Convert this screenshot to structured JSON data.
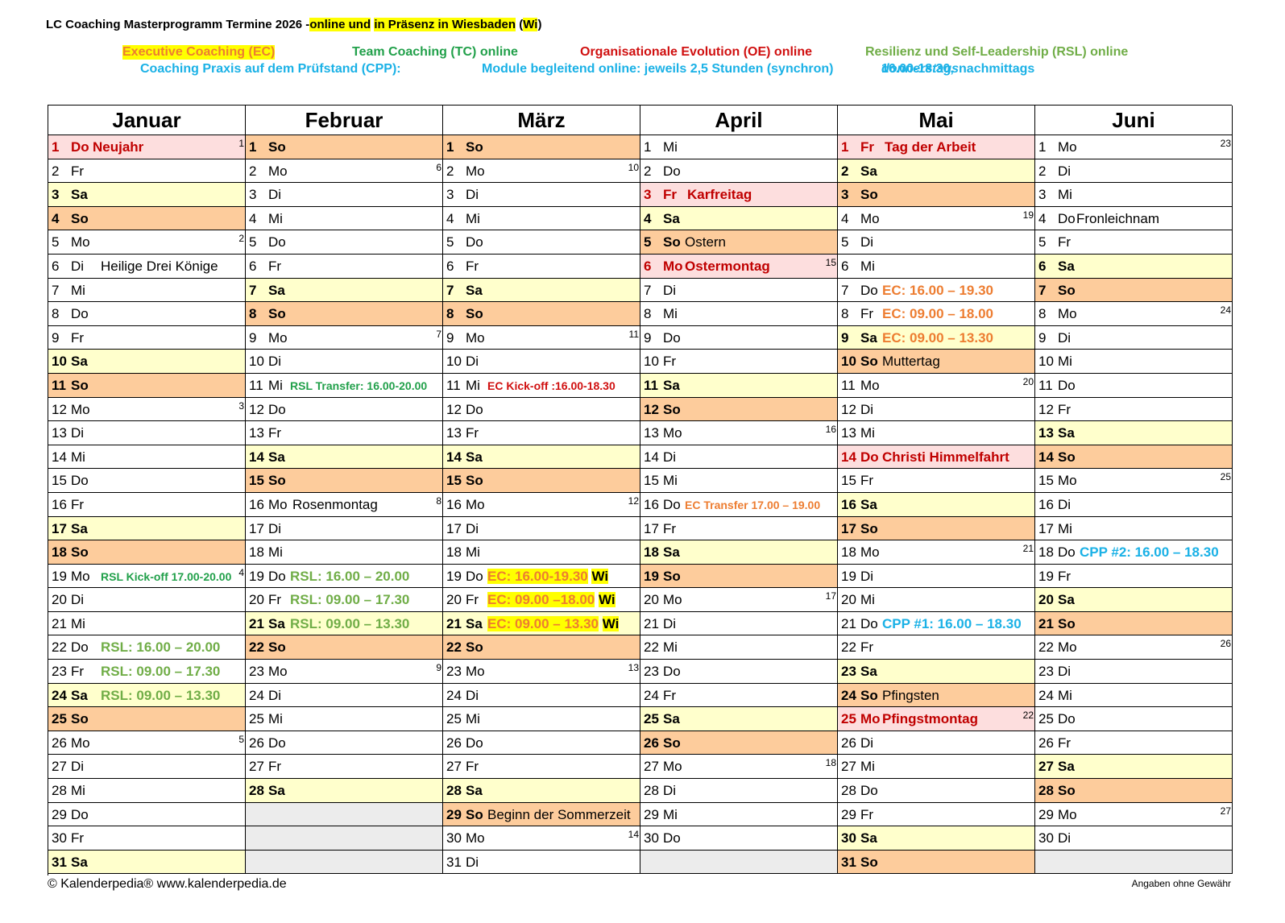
{
  "title": {
    "main": "LC Coaching Masterprogramm Termine 2026 -",
    "hl1": "online und",
    "mid": " ",
    "hl2": "in Präsenz in Wiesbaden",
    "paren_open": " (",
    "hl3": "Wi",
    "paren_close": ")"
  },
  "legend": {
    "ec": "Executive Coaching (EC)",
    "tc": "Team Coaching (TC) online",
    "oe": "Organisationale Evolution (OE) online",
    "rsl": "Resilienz und Self-Leadership (RSL) online",
    "cpp": "Coaching Praxis auf dem Prüfstand (CPP):",
    "modules": "Module begleitend online: jeweils 2,5 Stunden (synchron)",
    "time": "16.00-18.30,",
    "weekday": "donnerstags",
    "afternoon": "nachmittags"
  },
  "colors": {
    "ec": "#ed7d31",
    "tc": "#21a04a",
    "oe": "#d01010",
    "rsl": "#70ad47",
    "cpp": "#1ab1e6",
    "saturday": "#ffffcc",
    "sunday": "#fdcc9c",
    "holiday": "#fddede"
  },
  "months": [
    {
      "name": "Januar",
      "days": [
        {
          "n": "1",
          "d": "Do",
          "t": "hol",
          "note": "Neujahr",
          "cls": "",
          "wk": "1"
        },
        {
          "n": "2",
          "d": "Fr"
        },
        {
          "n": "3",
          "d": "Sa",
          "t": "sa"
        },
        {
          "n": "4",
          "d": "So",
          "t": "so"
        },
        {
          "n": "5",
          "d": "Mo",
          "wk": "2"
        },
        {
          "n": "6",
          "d": "Di",
          "note": "Heilige Drei Könige",
          "pos": "wide"
        },
        {
          "n": "7",
          "d": "Mi"
        },
        {
          "n": "8",
          "d": "Do"
        },
        {
          "n": "9",
          "d": "Fr"
        },
        {
          "n": "10",
          "d": "Sa",
          "t": "sa"
        },
        {
          "n": "11",
          "d": "So",
          "t": "so"
        },
        {
          "n": "12",
          "d": "Mo",
          "wk": "3"
        },
        {
          "n": "13",
          "d": "Di"
        },
        {
          "n": "14",
          "d": "Mi"
        },
        {
          "n": "15",
          "d": "Do"
        },
        {
          "n": "16",
          "d": "Fr"
        },
        {
          "n": "17",
          "d": "Sa",
          "t": "sa"
        },
        {
          "n": "18",
          "d": "So",
          "t": "so"
        },
        {
          "n": "19",
          "d": "Mo",
          "note": "RSL Kick-off 17.00-20.00",
          "cls": "rslg small",
          "wk": "4"
        },
        {
          "n": "20",
          "d": "Di"
        },
        {
          "n": "21",
          "d": "Mi"
        },
        {
          "n": "22",
          "d": "Do",
          "note": "RSL: 16.00 – 20.00",
          "cls": "rsl"
        },
        {
          "n": "23",
          "d": "Fr",
          "note": "RSL: 09.00 – 17.30",
          "cls": "rsl"
        },
        {
          "n": "24",
          "d": "Sa",
          "t": "sa",
          "note": "RSL: 09.00 – 13.30",
          "cls": "rsl"
        },
        {
          "n": "25",
          "d": "So",
          "t": "so"
        },
        {
          "n": "26",
          "d": "Mo",
          "wk": "5"
        },
        {
          "n": "27",
          "d": "Di"
        },
        {
          "n": "28",
          "d": "Mi"
        },
        {
          "n": "29",
          "d": "Do"
        },
        {
          "n": "30",
          "d": "Fr"
        },
        {
          "n": "31",
          "d": "Sa",
          "t": "sa"
        }
      ]
    },
    {
      "name": "Februar",
      "days": [
        {
          "n": "1",
          "d": "So",
          "t": "so"
        },
        {
          "n": "2",
          "d": "Mo",
          "wk": "6"
        },
        {
          "n": "3",
          "d": "Di"
        },
        {
          "n": "4",
          "d": "Mi"
        },
        {
          "n": "5",
          "d": "Do"
        },
        {
          "n": "6",
          "d": "Fr"
        },
        {
          "n": "7",
          "d": "Sa",
          "t": "sa"
        },
        {
          "n": "8",
          "d": "So",
          "t": "so"
        },
        {
          "n": "9",
          "d": "Mo",
          "wk": "7"
        },
        {
          "n": "10",
          "d": "Di"
        },
        {
          "n": "11",
          "d": "Mi",
          "note": "RSL Transfer: 16.00-20.00",
          "cls": "rslg small"
        },
        {
          "n": "12",
          "d": "Do"
        },
        {
          "n": "13",
          "d": "Fr"
        },
        {
          "n": "14",
          "d": "Sa",
          "t": "sa"
        },
        {
          "n": "15",
          "d": "So",
          "t": "so"
        },
        {
          "n": "16",
          "d": "Mo",
          "note": "Rosenmontag",
          "cls": "",
          "wk": "8"
        },
        {
          "n": "17",
          "d": "Di"
        },
        {
          "n": "18",
          "d": "Mi"
        },
        {
          "n": "19",
          "d": "Do",
          "note": "RSL: 16.00 – 20.00",
          "cls": "rsl"
        },
        {
          "n": "20",
          "d": "Fr",
          "note": "RSL: 09.00 – 17.30",
          "cls": "rsl"
        },
        {
          "n": "21",
          "d": "Sa",
          "t": "sa",
          "note": "RSL: 09.00 – 13.30",
          "cls": "rsl"
        },
        {
          "n": "22",
          "d": "So",
          "t": "so"
        },
        {
          "n": "23",
          "d": "Mo",
          "wk": "9"
        },
        {
          "n": "24",
          "d": "Di"
        },
        {
          "n": "25",
          "d": "Mi"
        },
        {
          "n": "26",
          "d": "Do"
        },
        {
          "n": "27",
          "d": "Fr"
        },
        {
          "n": "28",
          "d": "Sa",
          "t": "sa"
        },
        {
          "n": "",
          "d": "",
          "t": "empty"
        },
        {
          "n": "",
          "d": "",
          "t": "empty"
        },
        {
          "n": "",
          "d": "",
          "t": "empty"
        }
      ]
    },
    {
      "name": "März",
      "days": [
        {
          "n": "1",
          "d": "So",
          "t": "so"
        },
        {
          "n": "2",
          "d": "Mo",
          "wk": "10"
        },
        {
          "n": "3",
          "d": "Di"
        },
        {
          "n": "4",
          "d": "Mi"
        },
        {
          "n": "5",
          "d": "Do"
        },
        {
          "n": "6",
          "d": "Fr"
        },
        {
          "n": "7",
          "d": "Sa",
          "t": "sa"
        },
        {
          "n": "8",
          "d": "So",
          "t": "so"
        },
        {
          "n": "9",
          "d": "Mo",
          "wk": "11"
        },
        {
          "n": "10",
          "d": "Di"
        },
        {
          "n": "11",
          "d": "Mi",
          "note": "EC Kick-off :16.00-18.30",
          "cls": "red small"
        },
        {
          "n": "12",
          "d": "Do"
        },
        {
          "n": "13",
          "d": "Fr"
        },
        {
          "n": "14",
          "d": "Sa",
          "t": "sa"
        },
        {
          "n": "15",
          "d": "So",
          "t": "so"
        },
        {
          "n": "16",
          "d": "Mo",
          "wk": "12"
        },
        {
          "n": "17",
          "d": "Di"
        },
        {
          "n": "18",
          "d": "Mi"
        },
        {
          "n": "19",
          "d": "Do",
          "note": "EC: 16.00-19.30",
          "cls": "ecy",
          "wi": "Wi"
        },
        {
          "n": "20",
          "d": "Fr",
          "note": "EC: 09.00 –18.00",
          "cls": "ecy",
          "wi": "Wi"
        },
        {
          "n": "21",
          "d": "Sa",
          "t": "sa",
          "note": "EC: 09.00 – 13.30",
          "cls": "ecy",
          "wi": "Wi"
        },
        {
          "n": "22",
          "d": "So",
          "t": "so"
        },
        {
          "n": "23",
          "d": "Mo",
          "wk": "13"
        },
        {
          "n": "24",
          "d": "Di"
        },
        {
          "n": "25",
          "d": "Mi"
        },
        {
          "n": "26",
          "d": "Do"
        },
        {
          "n": "27",
          "d": "Fr"
        },
        {
          "n": "28",
          "d": "Sa",
          "t": "sa"
        },
        {
          "n": "29",
          "d": "So",
          "t": "so",
          "note": "Beginn der Sommerzeit",
          "cls": "plain"
        },
        {
          "n": "30",
          "d": "Mo",
          "wk": "14"
        },
        {
          "n": "31",
          "d": "Di"
        }
      ]
    },
    {
      "name": "April",
      "days": [
        {
          "n": "1",
          "d": "Mi"
        },
        {
          "n": "2",
          "d": "Do"
        },
        {
          "n": "3",
          "d": "Fr",
          "t": "hol",
          "note": "Karfreitag"
        },
        {
          "n": "4",
          "d": "Sa",
          "t": "sa"
        },
        {
          "n": "5",
          "d": "So",
          "t": "so",
          "note": "Ostern",
          "cls": "plain"
        },
        {
          "n": "6",
          "d": "Mo",
          "t": "hol",
          "note": "Ostermontag",
          "wk": "15"
        },
        {
          "n": "7",
          "d": "Di"
        },
        {
          "n": "8",
          "d": "Mi"
        },
        {
          "n": "9",
          "d": "Do"
        },
        {
          "n": "10",
          "d": "Fr"
        },
        {
          "n": "11",
          "d": "Sa",
          "t": "sa"
        },
        {
          "n": "12",
          "d": "So",
          "t": "so"
        },
        {
          "n": "13",
          "d": "Mo",
          "wk": "16"
        },
        {
          "n": "14",
          "d": "Di"
        },
        {
          "n": "15",
          "d": "Mi"
        },
        {
          "n": "16",
          "d": "Do",
          "note": "EC Transfer 17.00 – 19.00",
          "cls": "ec small"
        },
        {
          "n": "17",
          "d": "Fr"
        },
        {
          "n": "18",
          "d": "Sa",
          "t": "sa"
        },
        {
          "n": "19",
          "d": "So",
          "t": "so"
        },
        {
          "n": "20",
          "d": "Mo",
          "wk": "17"
        },
        {
          "n": "21",
          "d": "Di"
        },
        {
          "n": "22",
          "d": "Mi"
        },
        {
          "n": "23",
          "d": "Do"
        },
        {
          "n": "24",
          "d": "Fr"
        },
        {
          "n": "25",
          "d": "Sa",
          "t": "sa"
        },
        {
          "n": "26",
          "d": "So",
          "t": "so"
        },
        {
          "n": "27",
          "d": "Mo",
          "wk": "18"
        },
        {
          "n": "28",
          "d": "Di"
        },
        {
          "n": "29",
          "d": "Mi"
        },
        {
          "n": "30",
          "d": "Do"
        },
        {
          "n": "",
          "d": "",
          "t": "empty"
        }
      ]
    },
    {
      "name": "Mai",
      "days": [
        {
          "n": "1",
          "d": "Fr",
          "t": "hol",
          "note": "Tag der Arbeit"
        },
        {
          "n": "2",
          "d": "Sa",
          "t": "sa"
        },
        {
          "n": "3",
          "d": "So",
          "t": "so"
        },
        {
          "n": "4",
          "d": "Mo",
          "wk": "19"
        },
        {
          "n": "5",
          "d": "Di"
        },
        {
          "n": "6",
          "d": "Mi"
        },
        {
          "n": "7",
          "d": "Do",
          "note": "EC: 16.00 – 19.30",
          "cls": "ec"
        },
        {
          "n": "8",
          "d": "Fr",
          "note": "EC: 09.00 – 18.00",
          "cls": "ec"
        },
        {
          "n": "9",
          "d": "Sa",
          "t": "sa",
          "note": "EC: 09.00 – 13.30",
          "cls": "ec"
        },
        {
          "n": "10",
          "d": "So",
          "t": "so",
          "note": "Muttertag",
          "cls": "plain"
        },
        {
          "n": "11",
          "d": "Mo",
          "wk": "20"
        },
        {
          "n": "12",
          "d": "Di"
        },
        {
          "n": "13",
          "d": "Mi"
        },
        {
          "n": "14",
          "d": "Do",
          "t": "hol",
          "note": "Christi Himmelfahrt"
        },
        {
          "n": "15",
          "d": "Fr"
        },
        {
          "n": "16",
          "d": "Sa",
          "t": "sa"
        },
        {
          "n": "17",
          "d": "So",
          "t": "so"
        },
        {
          "n": "18",
          "d": "Mo",
          "wk": "21"
        },
        {
          "n": "19",
          "d": "Di"
        },
        {
          "n": "20",
          "d": "Mi"
        },
        {
          "n": "21",
          "d": "Do",
          "note": "CPP #1: 16.00 – 18.30",
          "cls": "cpp"
        },
        {
          "n": "22",
          "d": "Fr"
        },
        {
          "n": "23",
          "d": "Sa",
          "t": "sa"
        },
        {
          "n": "24",
          "d": "So",
          "t": "so",
          "note": "Pfingsten",
          "cls": "plain"
        },
        {
          "n": "25",
          "d": "Mo",
          "t": "hol",
          "note": "Pfingstmontag",
          "wk": "22"
        },
        {
          "n": "26",
          "d": "Di"
        },
        {
          "n": "27",
          "d": "Mi"
        },
        {
          "n": "28",
          "d": "Do"
        },
        {
          "n": "29",
          "d": "Fr"
        },
        {
          "n": "30",
          "d": "Sa",
          "t": "sa"
        },
        {
          "n": "31",
          "d": "So",
          "t": "so"
        }
      ]
    },
    {
      "name": "Juni",
      "days": [
        {
          "n": "1",
          "d": "Mo",
          "wk": "23"
        },
        {
          "n": "2",
          "d": "Di"
        },
        {
          "n": "3",
          "d": "Mi"
        },
        {
          "n": "4",
          "d": "Do",
          "note": "Fronleichnam",
          "cls": "plainb"
        },
        {
          "n": "5",
          "d": "Fr"
        },
        {
          "n": "6",
          "d": "Sa",
          "t": "sa"
        },
        {
          "n": "7",
          "d": "So",
          "t": "so"
        },
        {
          "n": "8",
          "d": "Mo",
          "wk": "24"
        },
        {
          "n": "9",
          "d": "Di"
        },
        {
          "n": "10",
          "d": "Mi"
        },
        {
          "n": "11",
          "d": "Do"
        },
        {
          "n": "12",
          "d": "Fr"
        },
        {
          "n": "13",
          "d": "Sa",
          "t": "sa"
        },
        {
          "n": "14",
          "d": "So",
          "t": "so"
        },
        {
          "n": "15",
          "d": "Mo",
          "wk": "25"
        },
        {
          "n": "16",
          "d": "Di"
        },
        {
          "n": "17",
          "d": "Mi"
        },
        {
          "n": "18",
          "d": "Do",
          "note": "CPP #2: 16.00 – 18.30",
          "cls": "cpp"
        },
        {
          "n": "19",
          "d": "Fr"
        },
        {
          "n": "20",
          "d": "Sa",
          "t": "sa"
        },
        {
          "n": "21",
          "d": "So",
          "t": "so"
        },
        {
          "n": "22",
          "d": "Mo",
          "wk": "26"
        },
        {
          "n": "23",
          "d": "Di"
        },
        {
          "n": "24",
          "d": "Mi"
        },
        {
          "n": "25",
          "d": "Do"
        },
        {
          "n": "26",
          "d": "Fr"
        },
        {
          "n": "27",
          "d": "Sa",
          "t": "sa"
        },
        {
          "n": "28",
          "d": "So",
          "t": "so"
        },
        {
          "n": "29",
          "d": "Mo",
          "wk": "27"
        },
        {
          "n": "30",
          "d": "Di"
        },
        {
          "n": "",
          "d": "",
          "t": "empty"
        }
      ]
    }
  ],
  "footer": {
    "left": "© Kalenderpedia®   www.kalenderpedia.de",
    "right": "Angaben ohne Gewähr"
  }
}
